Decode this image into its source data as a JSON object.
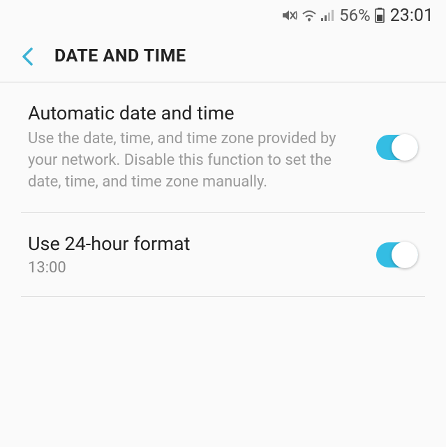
{
  "status": {
    "battery_percent": "56%",
    "clock": "23:01"
  },
  "header": {
    "title": "DATE AND TIME"
  },
  "settings": {
    "auto_datetime": {
      "title": "Automatic date and time",
      "desc": "Use the date, time, and time zone provided by your network. Disable this function to set the date, time, and time zone manually.",
      "enabled": true
    },
    "use_24h": {
      "title": "Use 24-hour format",
      "example": "13:00",
      "enabled": true
    }
  }
}
